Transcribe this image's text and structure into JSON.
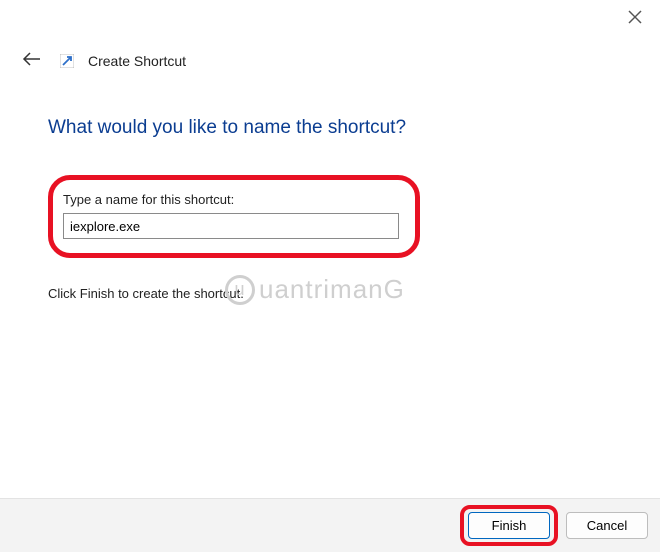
{
  "header": {
    "title": "Create Shortcut"
  },
  "main": {
    "heading": "What would you like to name the shortcut?",
    "field_label": "Type a name for this shortcut:",
    "name_value": "iexplore.exe",
    "instruction": "Click Finish to create the shortcut."
  },
  "watermark": {
    "text": "uantrimanG"
  },
  "footer": {
    "finish": "Finish",
    "cancel": "Cancel"
  }
}
